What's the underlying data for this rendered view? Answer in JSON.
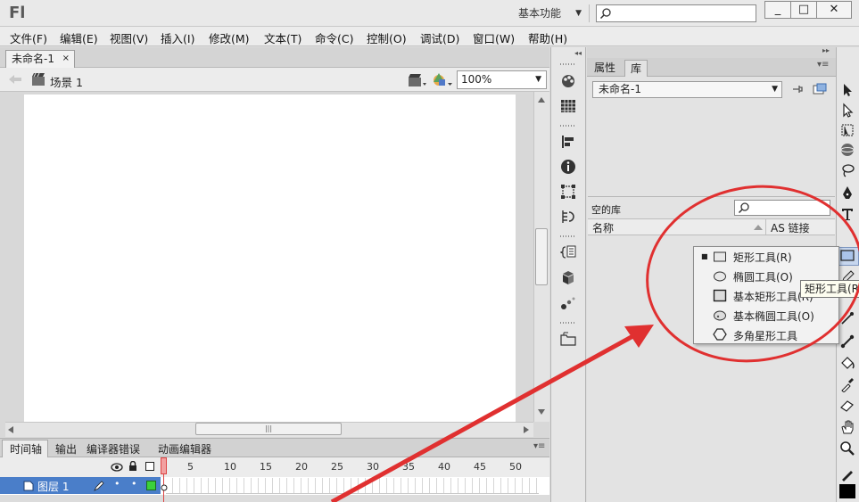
{
  "app": {
    "logo": "Fl",
    "workspace": "基本功能",
    "search_placeholder": "",
    "window_buttons": [
      "_",
      "□",
      "✕"
    ]
  },
  "menu": [
    "文件(F)",
    "编辑(E)",
    "视图(V)",
    "插入(I)",
    "修改(M)",
    "文本(T)",
    "命令(C)",
    "控制(O)",
    "调试(D)",
    "窗口(W)",
    "帮助(H)"
  ],
  "document": {
    "tab_title": "未命名-1",
    "tab_close": "×",
    "scene": "场景 1",
    "zoom": "100%"
  },
  "timeline": {
    "tabs": [
      "时间轴",
      "输出",
      "编译器错误",
      "动画编辑器"
    ],
    "frame_numbers": [
      "1",
      "5",
      "10",
      "15",
      "20",
      "25",
      "30",
      "35",
      "40",
      "45",
      "50"
    ],
    "layer_name": "图层 1"
  },
  "library": {
    "tabs": [
      "属性",
      "库"
    ],
    "active_tab": "库",
    "document_select": "未命名-1",
    "item_count": "空的库",
    "columns": [
      "名称",
      "AS 链接"
    ]
  },
  "tool_flyout": {
    "items": [
      {
        "label": "矩形工具(R)",
        "icon": "rectangle-icon",
        "selected": true
      },
      {
        "label": "椭圆工具(O)",
        "icon": "oval-icon",
        "selected": false
      },
      {
        "label": "基本矩形工具(R)",
        "icon": "primitive-rectangle-icon",
        "selected": false
      },
      {
        "label": "基本椭圆工具(O)",
        "icon": "primitive-oval-icon",
        "selected": false
      },
      {
        "label": "多角星形工具",
        "icon": "polystar-icon",
        "selected": false
      }
    ],
    "tooltip": "矩形工具(R)"
  },
  "colors": {
    "annotation": "#e03030",
    "layer_selected": "#4a7ec9",
    "playhead": "#dd4444",
    "stage": "#ffffff"
  }
}
